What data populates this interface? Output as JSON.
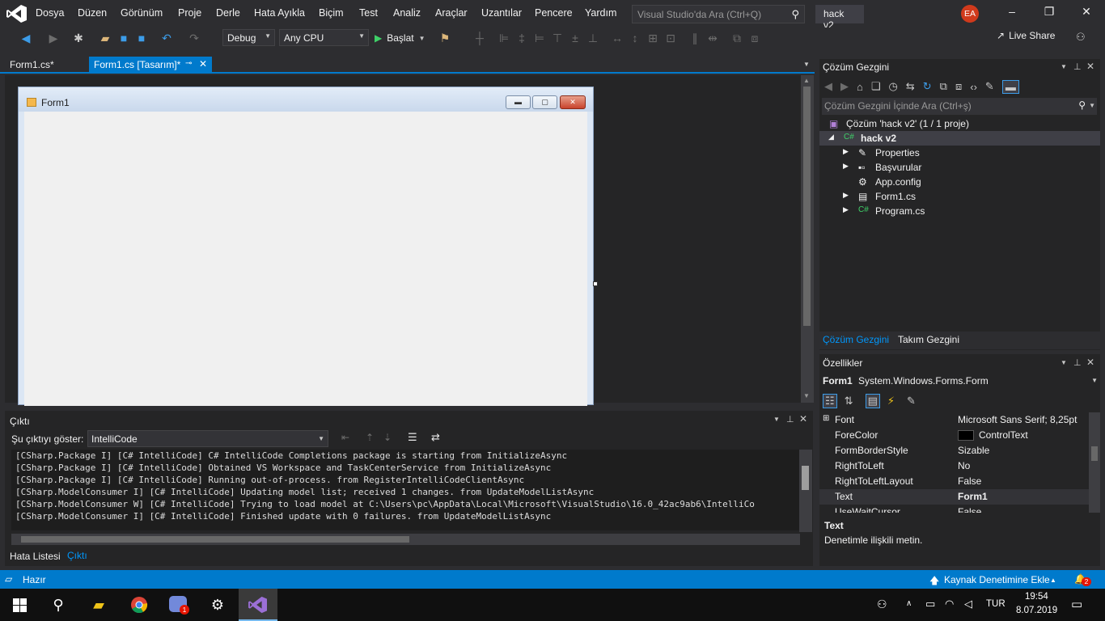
{
  "menu": {
    "items": [
      "Dosya",
      "Düzen",
      "Görünüm",
      "Proje",
      "Derle",
      "Hata Ayıkla",
      "Biçim",
      "Test",
      "Analiz",
      "Araçlar",
      "Uzantılar",
      "Pencere",
      "Yardım"
    ],
    "search_placeholder": "Visual Studio'da Ara (Ctrl+Q)",
    "solution_name": "hack v2",
    "avatar_initials": "EA"
  },
  "toolbar": {
    "config": "Debug",
    "platform": "Any CPU",
    "start_label": "Başlat",
    "liveshare_label": "Live Share"
  },
  "tabs": {
    "code": "Form1.cs*",
    "design": "Form1.cs [Tasarım]*"
  },
  "designer": {
    "form_title": "Form1"
  },
  "output": {
    "title": "Çıktı",
    "show_label": "Şu çıktıyı göster:",
    "source": "IntelliCode",
    "lines": [
      "[CSharp.Package I] [C# IntelliCode] C# IntelliCode Completions package is starting from InitializeAsync",
      "[CSharp.Package I] [C# IntelliCode] Obtained VS Workspace and TaskCenterService from InitializeAsync",
      "[CSharp.Package I] [C# IntelliCode] Running out-of-process. from RegisterIntelliCodeClientAsync",
      "[CSharp.ModelConsumer I] [C# IntelliCode] Updating model list; received 1 changes. from UpdateModelListAsync",
      "[CSharp.ModelConsumer W] [C# IntelliCode] Trying to load model at C:\\Users\\pc\\AppData\\Local\\Microsoft\\VisualStudio\\16.0_42ac9ab6\\IntelliCo",
      "[CSharp.ModelConsumer I] [C# IntelliCode] Finished update with 0 failures. from UpdateModelListAsync"
    ],
    "tabs": [
      "Hata Listesi",
      "Çıktı"
    ]
  },
  "solution_explorer": {
    "title": "Çözüm Gezgini",
    "search_placeholder": "Çözüm Gezgini İçinde Ara (Ctrl+ş)",
    "solution_label": "Çözüm 'hack v2' (1 / 1 proje)",
    "project": "hack v2",
    "items": [
      "Properties",
      "Başvurular",
      "App.config",
      "Form1.cs",
      "Program.cs"
    ],
    "tabs": [
      "Çözüm Gezgini",
      "Takım Gezgini"
    ]
  },
  "properties": {
    "title": "Özellikler",
    "object": "Form1",
    "object_type": "System.Windows.Forms.Form",
    "rows": [
      {
        "name": "Font",
        "value": "Microsoft Sans Serif; 8,25pt"
      },
      {
        "name": "ForeColor",
        "value": "ControlText"
      },
      {
        "name": "FormBorderStyle",
        "value": "Sizable"
      },
      {
        "name": "RightToLeft",
        "value": "No"
      },
      {
        "name": "RightToLeftLayout",
        "value": "False"
      },
      {
        "name": "Text",
        "value": "Form1"
      },
      {
        "name": "UseWaitCursor",
        "value": "False"
      }
    ],
    "desc_title": "Text",
    "desc_text": "Denetimle ilişkili metin."
  },
  "statusbar": {
    "left": "Hazır",
    "right": "Kaynak Denetimine Ekle",
    "notification_count": "2"
  },
  "taskbar": {
    "lang": "TUR",
    "time": "19:54",
    "date": "8.07.2019",
    "discord_badge": "1"
  },
  "colors": {
    "accent": "#007acc",
    "bg": "#2d2d30",
    "panel": "#252526"
  }
}
